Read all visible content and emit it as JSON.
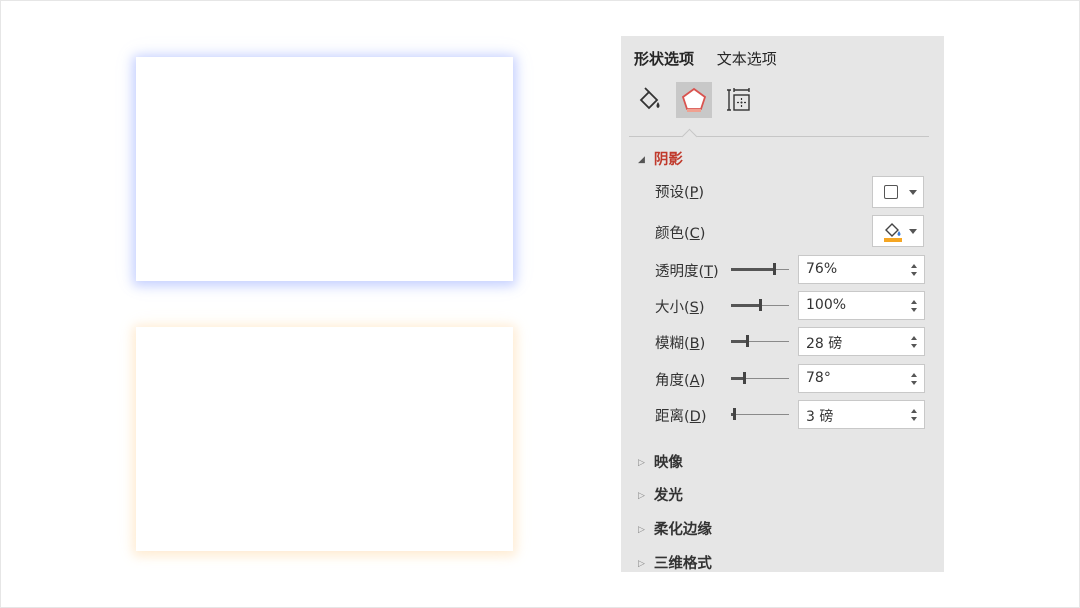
{
  "panel": {
    "tabs": [
      "形状选项",
      "文本选项"
    ],
    "icons": [
      "fill-line-icon",
      "effects-pentagon-icon",
      "size-properties-icon"
    ],
    "shadow": {
      "title": "阴影",
      "preset_label": "预设(",
      "preset_key": "P",
      "color_label": "颜色(",
      "color_key": "C",
      "color_swatch": "#f5a623",
      "rows": [
        {
          "label": "透明度(",
          "key": "T",
          "value": "76%",
          "level": 0.76
        },
        {
          "label": "大小(",
          "key": "S",
          "value": "100%",
          "level": 0.5
        },
        {
          "label": "模糊(",
          "key": "B",
          "value": "28 磅",
          "level": 0.28
        },
        {
          "label": "角度(",
          "key": "A",
          "value": "78°",
          "level": 0.22
        },
        {
          "label": "距离(",
          "key": "D",
          "value": "3 磅",
          "level": 0.03
        }
      ]
    },
    "collapsed_sections": [
      "映像",
      "发光",
      "柔化边缘",
      "三维格式"
    ]
  },
  "colors": {
    "accent_red": "#c0392b",
    "blue_glow": "#96aaff",
    "orange_glow": "#ffd7a0"
  }
}
